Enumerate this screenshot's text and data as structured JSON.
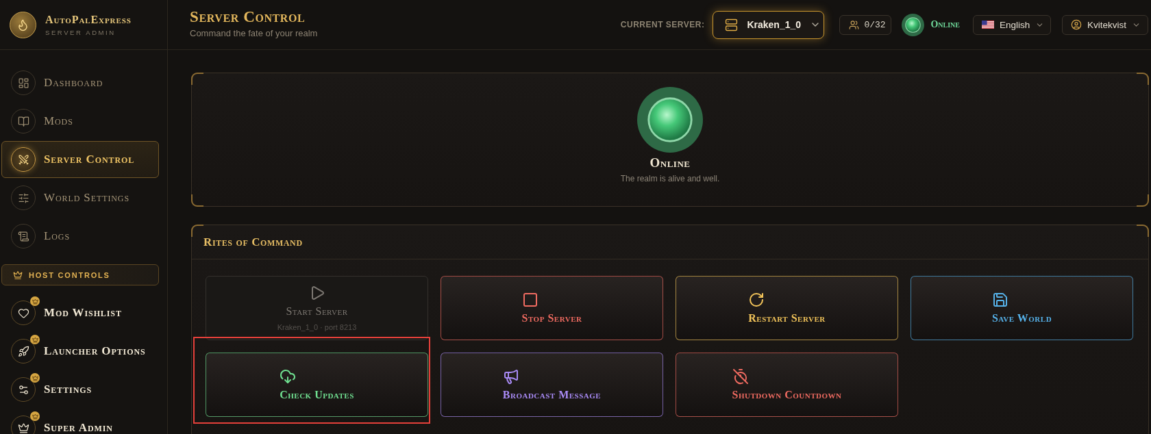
{
  "sidebar": {
    "brand": {
      "name": "AutoPalExpress",
      "tagline": "SERVER ADMIN"
    },
    "nav_items": [
      {
        "kind": "dashboard",
        "label": "Dashboard",
        "selected": false
      },
      {
        "kind": "mods",
        "label": "Mods",
        "selected": false
      },
      {
        "kind": "swords",
        "label": "Server Control",
        "selected": true
      },
      {
        "kind": "sliders",
        "label": "World Settings",
        "selected": false
      },
      {
        "kind": "scroll",
        "label": "Logs",
        "selected": false
      }
    ],
    "host_section": {
      "title": "HOST CONTROLS",
      "items": [
        {
          "kind": "heart",
          "label": "Mod Wishlist",
          "selected": false
        },
        {
          "kind": "rocket",
          "label": "Launcher Options",
          "selected": false
        },
        {
          "kind": "settings",
          "label": "Settings",
          "selected": false
        },
        {
          "kind": "crown",
          "label": "Super Admin",
          "selected": false
        }
      ]
    }
  },
  "header": {
    "title": "Server Control",
    "subtitle": "Command the fate of your realm",
    "server_label": "CURRENT SERVER:",
    "server_select": {
      "value": "Kraken_1_0"
    },
    "players": "0/32",
    "status": {
      "online": true,
      "label": "Online"
    },
    "language": {
      "value": "English"
    },
    "user": {
      "name": "Kvitekvist"
    }
  },
  "status_panel": {
    "online": true,
    "title": "Online",
    "message": "The realm is alive and well."
  },
  "commands_panel": {
    "title": "Rites of Command",
    "actions": [
      {
        "kind": "start",
        "label": "Start Server",
        "detail": "Kraken_1_0 · port 8213",
        "disabled": true,
        "highlighted": false,
        "color": "#7d7872"
      },
      {
        "kind": "stop",
        "label": "Stop Server",
        "disabled": false,
        "highlighted": false,
        "color": "#f06b61"
      },
      {
        "kind": "restart",
        "label": "Restart Server",
        "disabled": false,
        "highlighted": false,
        "color": "#f2c45a"
      },
      {
        "kind": "save",
        "label": "Save World",
        "disabled": false,
        "highlighted": false,
        "color": "#56b2ea"
      },
      {
        "kind": "update",
        "label": "Check Updates",
        "disabled": false,
        "highlighted": true,
        "color": "#70e091"
      },
      {
        "kind": "broadcast",
        "label": "Broadcast Message",
        "disabled": false,
        "highlighted": false,
        "color": "#a98bf6"
      },
      {
        "kind": "shutdown",
        "label": "Shutdown Countdown",
        "disabled": false,
        "highlighted": false,
        "color": "#f06b61"
      }
    ]
  }
}
